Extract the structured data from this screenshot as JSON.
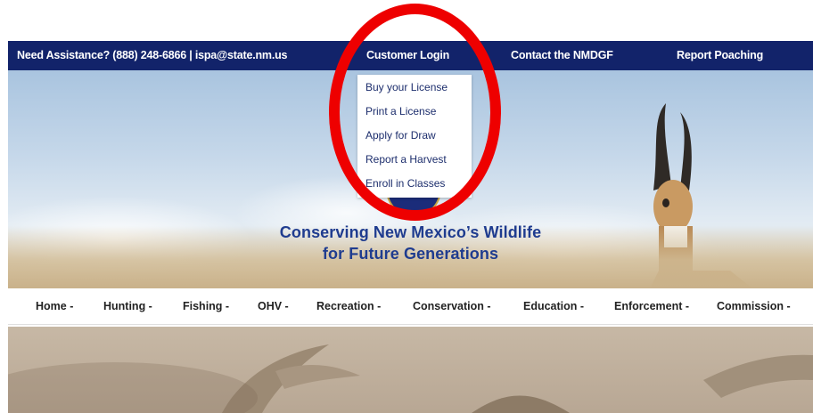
{
  "topbar": {
    "assistance": "Need Assistance? (888) 248-6866  |  ispa@state.nm.us",
    "customer_login": "Customer Login",
    "contact": "Contact the NMDGF",
    "report_poaching": "Report Poaching"
  },
  "dropdown": {
    "items": [
      "Buy your License",
      "Print a License",
      "Apply for Draw",
      "Report a Harvest",
      "Enroll in Classes"
    ]
  },
  "hero": {
    "tagline_line1": "Conserving New Mexico’s Wildlife",
    "tagline_line2": "for Future Generations"
  },
  "nav": {
    "items": [
      "Home -",
      "Hunting -",
      "Fishing -",
      "OHV -",
      "Recreation -",
      "Conservation -",
      "Education -",
      "Enforcement -",
      "Commission -"
    ]
  },
  "colors": {
    "topbar_bg": "#12236a",
    "tagline": "#1f3c8f",
    "annotation_circle": "#ee0000"
  }
}
